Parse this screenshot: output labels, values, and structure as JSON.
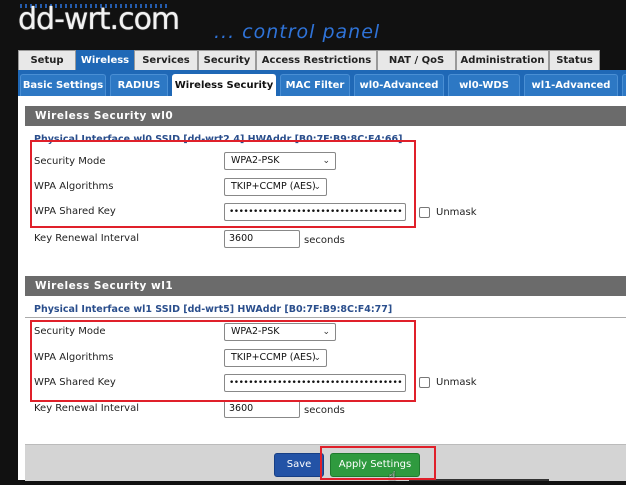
{
  "header": {
    "logo_text": "dd-wrt.com",
    "subtitle": "... control panel"
  },
  "main_tabs": [
    "Setup",
    "Wireless",
    "Services",
    "Security",
    "Access Restrictions",
    "NAT / QoS",
    "Administration",
    "Status"
  ],
  "main_tab_active": "Wireless",
  "sub_tabs": [
    "Basic Settings",
    "RADIUS",
    "Wireless Security",
    "MAC Filter",
    "wl0-Advanced",
    "wl0-WDS",
    "wl1-Advanced"
  ],
  "sub_tab_active": "Wireless Security",
  "sections": [
    {
      "title": "Wireless Security wl0",
      "physical_interface": "Physical Interface wl0 SSID [dd-wrt2.4] HWAddr [B0:7F:B9:8C:F4:66]",
      "security_mode_label": "Security Mode",
      "security_mode_value": "WPA2-PSK",
      "wpa_algorithms_label": "WPA Algorithms",
      "wpa_algorithms_value": "TKIP+CCMP (AES)",
      "wpa_key_label": "WPA Shared Key",
      "wpa_key_value": "••••••••••••••••••••••••••••••••••••",
      "unmask_label": "Unmask",
      "key_renewal_label": "Key Renewal Interval",
      "key_renewal_value": "3600",
      "key_renewal_unit": "seconds"
    },
    {
      "title": "Wireless Security wl1",
      "physical_interface": "Physical Interface wl1 SSID [dd-wrt5] HWAddr [B0:7F:B9:8C:F4:77]",
      "security_mode_label": "Security Mode",
      "security_mode_value": "WPA2-PSK",
      "wpa_algorithms_label": "WPA Algorithms",
      "wpa_algorithms_value": "TKIP+CCMP (AES)",
      "wpa_key_label": "WPA Shared Key",
      "wpa_key_value": "••••••••••••••••••••••••••••••••••••",
      "unmask_label": "Unmask",
      "key_renewal_label": "Key Renewal Interval",
      "key_renewal_value": "3600",
      "key_renewal_unit": "seconds"
    }
  ],
  "footer": {
    "save_label": "Save",
    "apply_label": "Apply Settings"
  },
  "colors": {
    "active_tab": "#1f68b6",
    "highlight_box": "#e0202a",
    "apply_button": "#2f9a3f",
    "save_button": "#2353a6"
  }
}
